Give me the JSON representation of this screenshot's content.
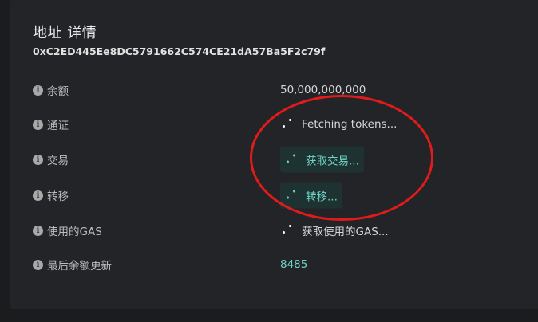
{
  "header": {
    "title": "地址 详情",
    "address": "0xC2ED445Ee8DC5791662C574CE21dA57Ba5F2c79f"
  },
  "rows": [
    {
      "label": "余额",
      "value": "50,000,000,000"
    },
    {
      "label": "通证",
      "value": "Fetching tokens..."
    },
    {
      "label": "交易",
      "value": "获取交易..."
    },
    {
      "label": "转移",
      "value": "转移..."
    },
    {
      "label": "使用的GAS",
      "value": "获取使用的GAS..."
    },
    {
      "label": "最后余额更新",
      "value": "8485"
    }
  ],
  "colors": {
    "accent": "#6fd3c6",
    "annotation": "#e11b1b"
  },
  "icons": {
    "info": "info-icon",
    "loading": "spinner-icon"
  }
}
